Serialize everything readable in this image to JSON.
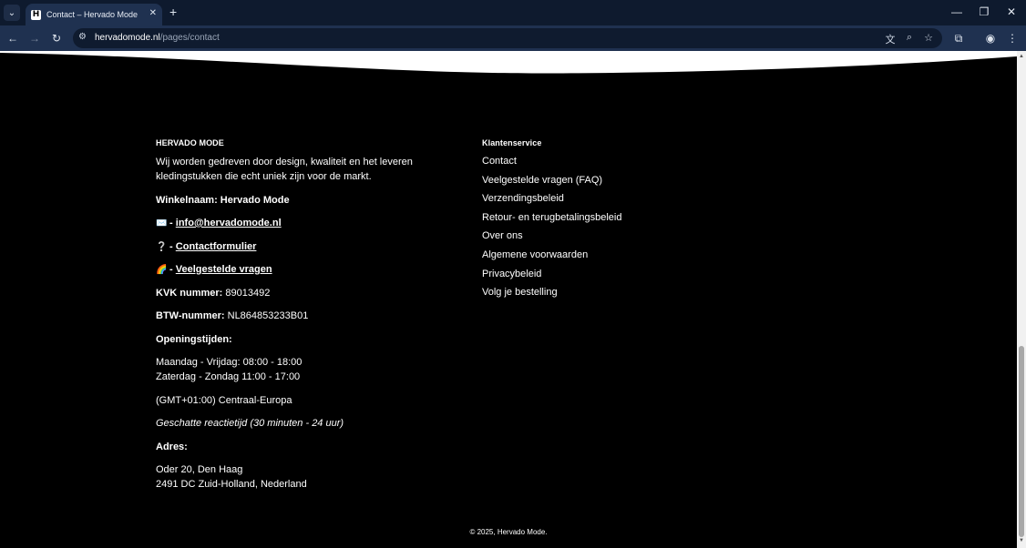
{
  "browser": {
    "tab_title": "Contact – Hervado Mode",
    "favicon_letter": "H",
    "url_host": "hervadomode.nl",
    "url_path": "/pages/contact"
  },
  "icons": {
    "tab_search": "⌄",
    "tab_close": "✕",
    "new_tab": "+",
    "minimize": "—",
    "restore": "❐",
    "close": "✕",
    "back": "←",
    "forward": "→",
    "reload": "↻",
    "site_info": "⚙",
    "translate": "文",
    "zoom": "⌕",
    "bookmark": "☆",
    "extensions": "⧉",
    "profile": "◉",
    "menu": "⋮",
    "scroll_up": "▲",
    "scroll_down": "▼"
  },
  "footer": {
    "brand_heading": "HERVADO MODE",
    "brand_text": "Wij worden gedreven door design, kwaliteit en het leveren kledingstukken die echt uniek zijn voor de markt.",
    "shop_name": "Winkelnaam: Hervado Mode",
    "email_emoji": "✉️",
    "email_sep": " - ",
    "email": "info@hervadomode.nl",
    "form_emoji": "❔",
    "form_sep": " - ",
    "form_link": "Contactformulier",
    "faq_emoji": "🌈",
    "faq_sep": " - ",
    "faq_link": "Veelgestelde vragen",
    "kvk_label": "KVK nummer:",
    "kvk_value": " 89013492",
    "btw_label": "BTW-nummer:",
    "btw_value": " NL864853233B01",
    "hours_label": "Openingstijden:",
    "hours_weekday": "Maandag - Vrijdag: 08:00 - 18:00",
    "hours_weekend": "Zaterdag - Zondag 11:00 - 17:00",
    "timezone": "(GMT+01:00) Centraal-Europa",
    "response_time": "Geschatte reactietijd (30 minuten - 24 uur)",
    "address_label": "Adres:",
    "address_line1": "Oder 20, Den Haag",
    "address_line2": "2491 DC Zuid-Holland, Nederland",
    "service_heading": "Klantenservice",
    "service_links": [
      "Contact",
      "Veelgestelde vragen (FAQ)",
      "Verzendingsbeleid",
      "Retour- en terugbetalingsbeleid",
      "Over ons",
      "Algemene voorwaarden",
      "Privacybeleid",
      "Volg je bestelling"
    ],
    "copyright": "© 2025, Hervado Mode."
  }
}
